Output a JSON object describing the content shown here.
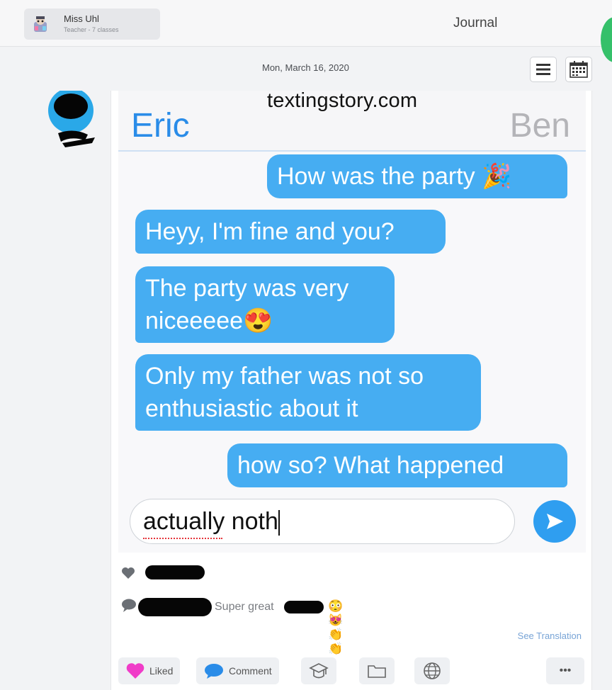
{
  "header": {
    "teacher_name": "Miss Uhl",
    "teacher_subtitle": "Teacher - 7 classes",
    "page_title": "Journal"
  },
  "post": {
    "date": "Mon, March 16, 2020"
  },
  "chat": {
    "watermark": "textingstory.com",
    "left_name": "Eric",
    "right_name": "Ben",
    "messages": [
      {
        "side": "right",
        "text": "How was the party 🎉"
      },
      {
        "side": "left",
        "text": "Heyy, I'm fine and you?"
      },
      {
        "side": "left",
        "line1": "The party was very",
        "line2": "niceeeee😍"
      },
      {
        "side": "left",
        "line1": "Only my father was not so",
        "line2": "enthusiastic about it"
      },
      {
        "side": "right",
        "text": "how so? What happened"
      }
    ],
    "input_value": "actually noth"
  },
  "feed": {
    "comment_text": "Super great",
    "comment_emojis": "😳😻👏👏",
    "see_translation": "See Translation"
  },
  "actions": {
    "liked_label": "Liked",
    "comment_label": "Comment",
    "more_label": "•••"
  },
  "colors": {
    "bubble": "#46adf2",
    "eric": "#2a8ce8",
    "liked_heart": "#f03cc8"
  }
}
